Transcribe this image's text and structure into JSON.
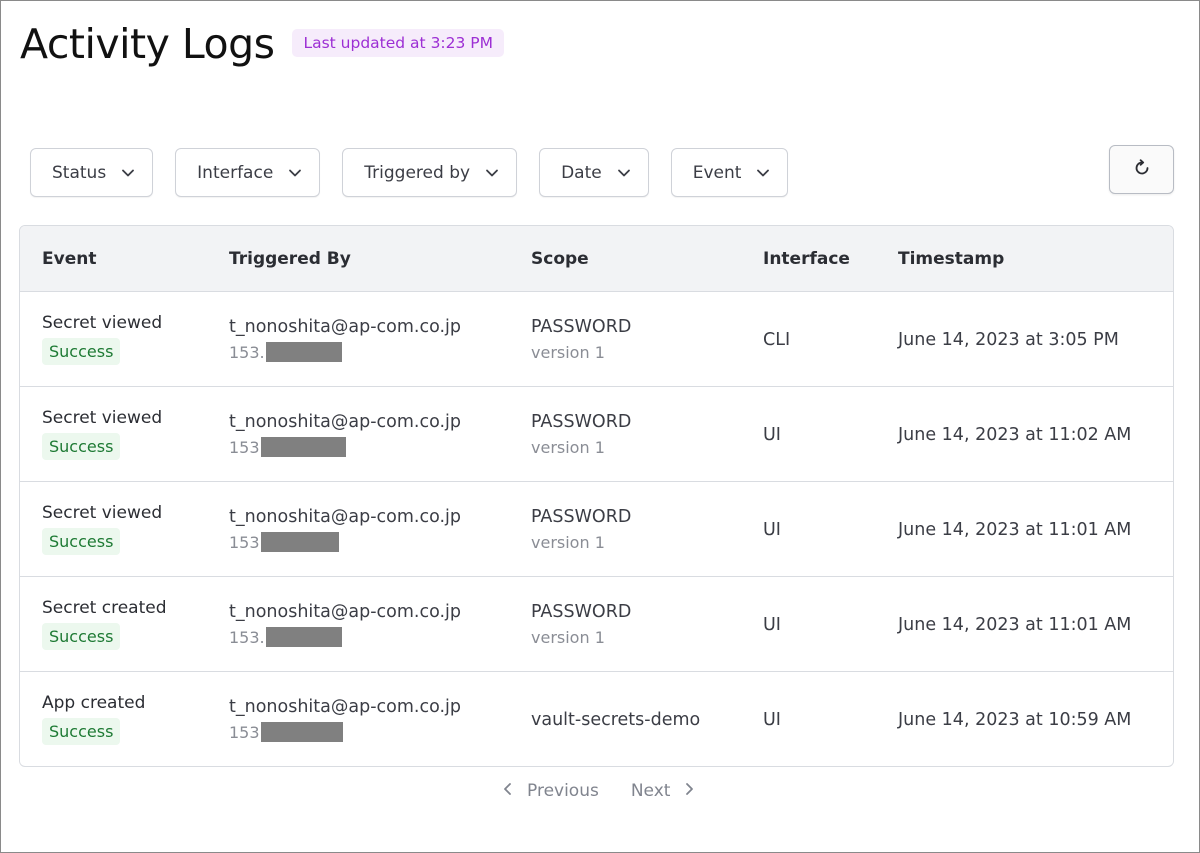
{
  "header": {
    "title": "Activity Logs",
    "last_updated": "Last updated at 3:23 PM"
  },
  "filters": [
    {
      "label": "Status",
      "icon": "chevron-down-icon"
    },
    {
      "label": "Interface",
      "icon": "chevron-down-icon"
    },
    {
      "label": "Triggered by",
      "icon": "chevron-down-icon"
    },
    {
      "label": "Date",
      "icon": "chevron-down-icon"
    },
    {
      "label": "Event",
      "icon": "chevron-down-icon"
    }
  ],
  "refresh": {
    "icon": "refresh-icon"
  },
  "table": {
    "columns": [
      "Event",
      "Triggered By",
      "Scope",
      "Interface",
      "Timestamp"
    ],
    "rows": [
      {
        "event": "Secret viewed",
        "status": "Success",
        "email": "t_nonoshita@ap-com.co.jp",
        "ip_prefix": "153.",
        "scope": "PASSWORD",
        "scope_version": "version 1",
        "interface": "CLI",
        "timestamp": "June 14, 2023 at 3:05 PM"
      },
      {
        "event": "Secret viewed",
        "status": "Success",
        "email": "t_nonoshita@ap-com.co.jp",
        "ip_prefix": "153",
        "scope": "PASSWORD",
        "scope_version": "version 1",
        "interface": "UI",
        "timestamp": "June 14, 2023 at 11:02 AM"
      },
      {
        "event": "Secret viewed",
        "status": "Success",
        "email": "t_nonoshita@ap-com.co.jp",
        "ip_prefix": "153",
        "scope": "PASSWORD",
        "scope_version": "version 1",
        "interface": "UI",
        "timestamp": "June 14, 2023 at 11:01 AM"
      },
      {
        "event": "Secret created",
        "status": "Success",
        "email": "t_nonoshita@ap-com.co.jp",
        "ip_prefix": "153.",
        "scope": "PASSWORD",
        "scope_version": "version 1",
        "interface": "UI",
        "timestamp": "June 14, 2023 at 11:01 AM"
      },
      {
        "event": "App created",
        "status": "Success",
        "email": "t_nonoshita@ap-com.co.jp",
        "ip_prefix": "153",
        "scope": "vault-secrets-demo",
        "scope_version": "",
        "interface": "UI",
        "timestamp": "June 14, 2023 at 10:59 AM"
      }
    ]
  },
  "pagination": {
    "previous_label": "Previous",
    "next_label": "Next"
  },
  "colors": {
    "badge_bg": "#f6ecfb",
    "badge_text": "#9d2fd4",
    "success_bg": "#ecf8ee",
    "success_text": "#1e7a34",
    "redaction": "#808080"
  }
}
